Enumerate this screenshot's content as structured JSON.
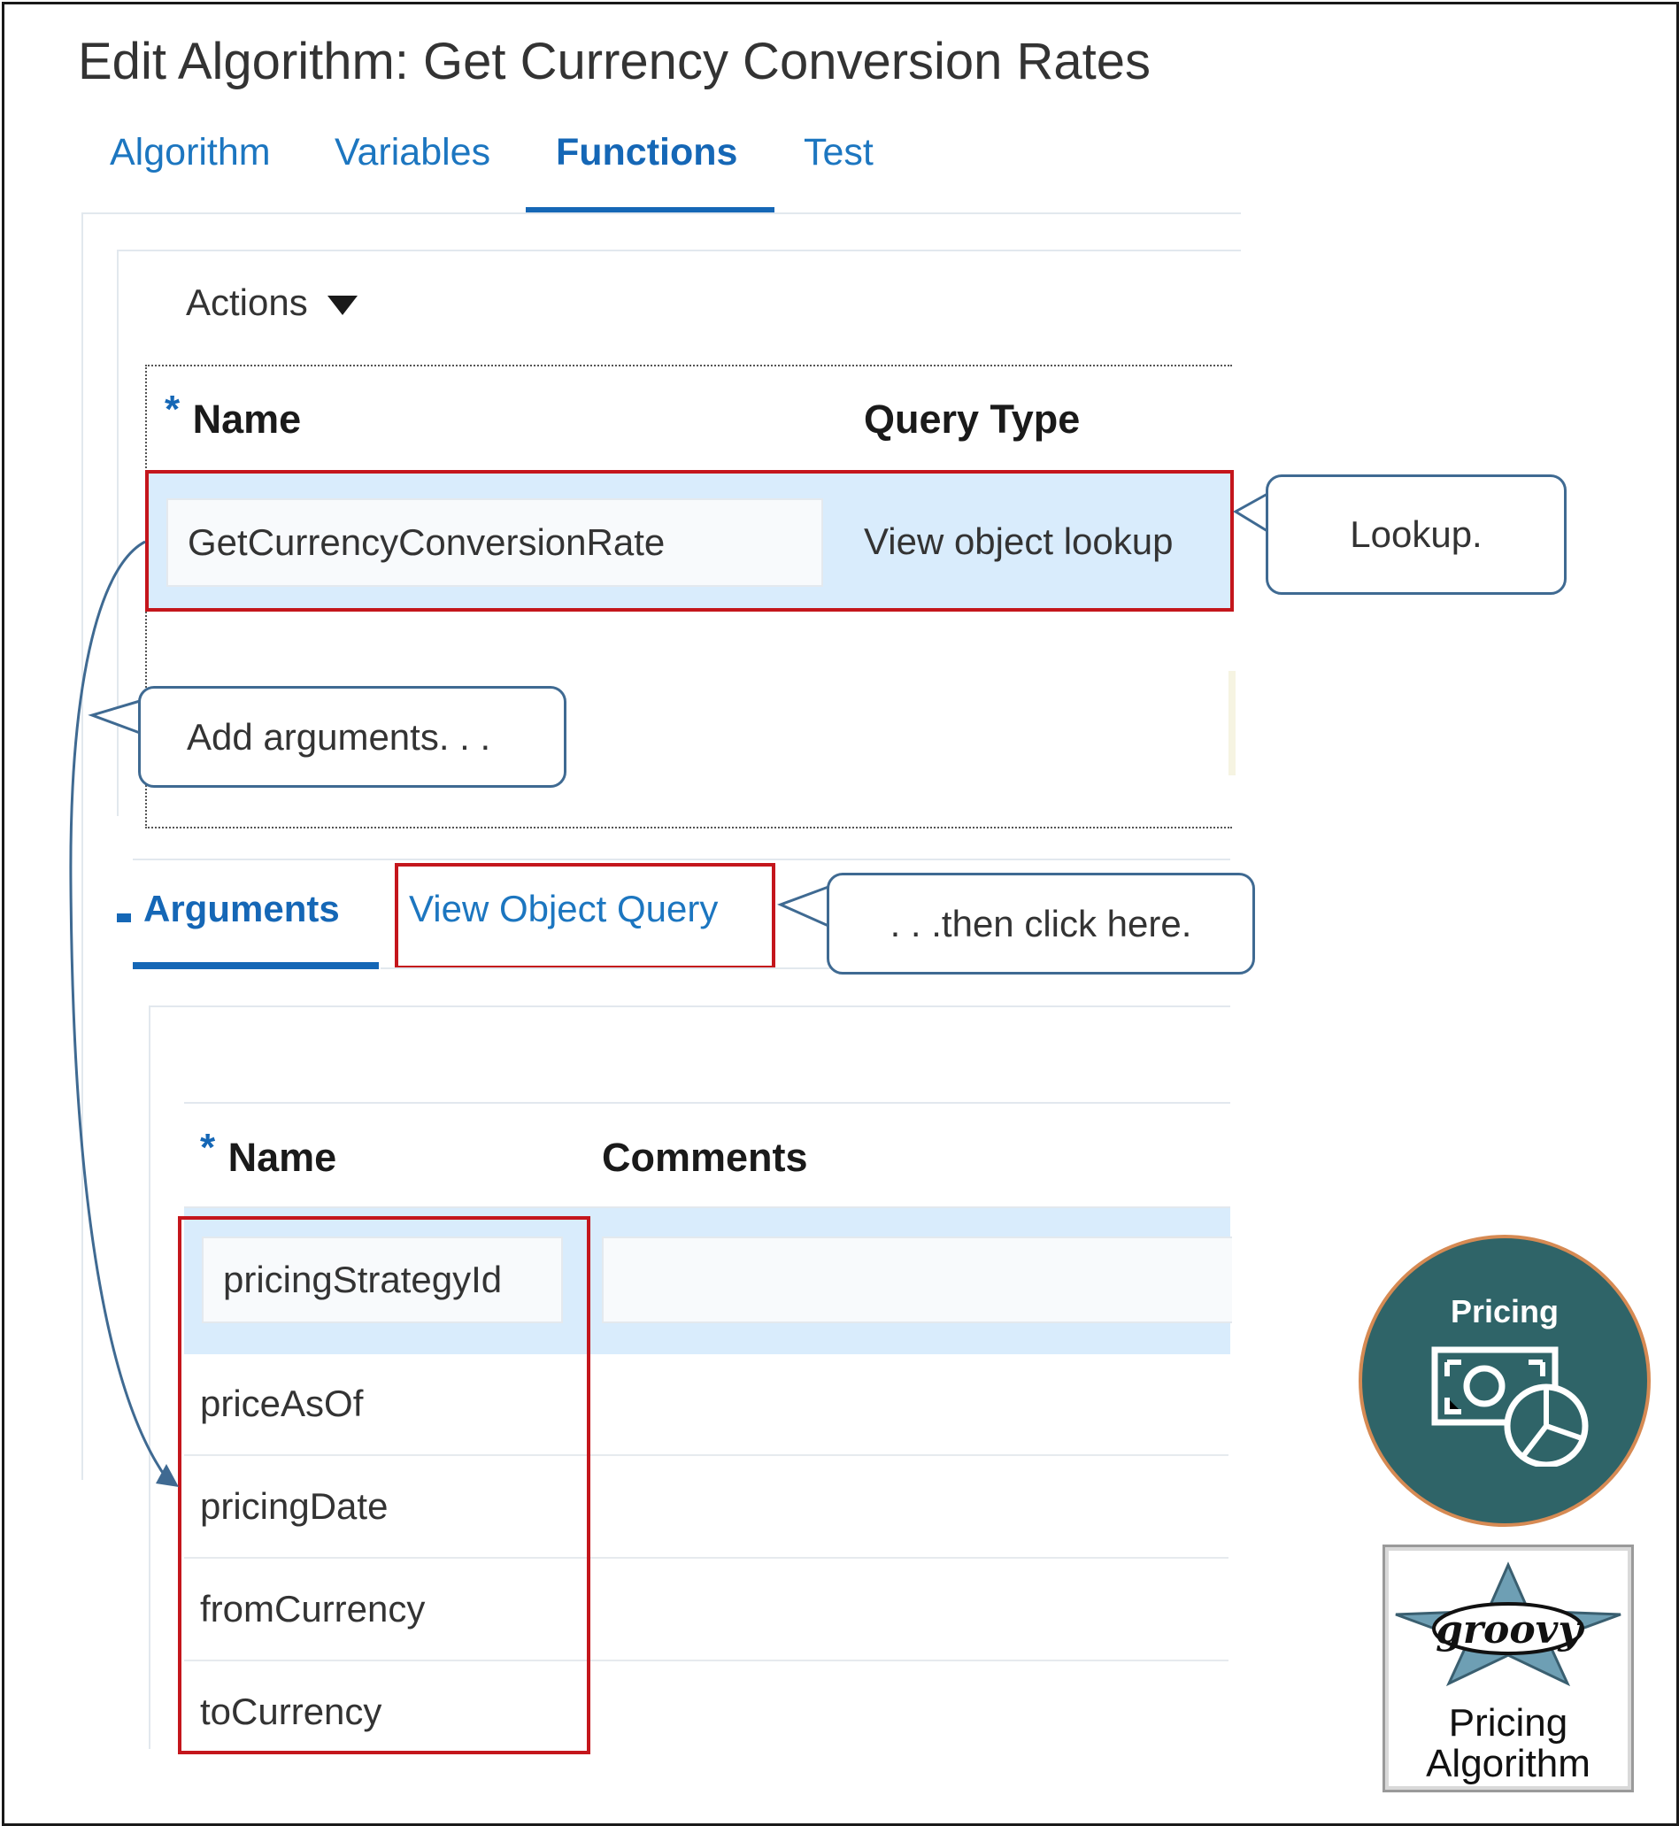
{
  "page": {
    "title": "Edit Algorithm: Get Currency Conversion Rates"
  },
  "tabs": [
    {
      "label": "Algorithm",
      "active": false
    },
    {
      "label": "Variables",
      "active": false
    },
    {
      "label": "Functions",
      "active": true
    },
    {
      "label": "Test",
      "active": false
    }
  ],
  "functions": {
    "actions_label": "Actions",
    "required_marker": "*",
    "columns": {
      "name": "Name",
      "query_type": "Query Type"
    },
    "rows": [
      {
        "name": "GetCurrencyConversionRate",
        "query_type": "View object lookup",
        "selected": true
      }
    ]
  },
  "subtabs": [
    {
      "label": "Arguments",
      "active": true
    },
    {
      "label": "View Object Query",
      "active": false
    }
  ],
  "arguments": {
    "required_marker": "*",
    "columns": {
      "name": "Name",
      "comments": "Comments"
    },
    "rows": [
      {
        "name": "pricingStrategyId",
        "comments": ""
      },
      {
        "name": "priceAsOf",
        "comments": ""
      },
      {
        "name": "pricingDate",
        "comments": ""
      },
      {
        "name": "fromCurrency",
        "comments": ""
      },
      {
        "name": "toCurrency",
        "comments": ""
      }
    ]
  },
  "callouts": {
    "lookup": "Lookup.",
    "add_arguments": "Add arguments. . .",
    "then_click": ". . .then click here."
  },
  "badges": {
    "pricing": {
      "label": "Pricing"
    },
    "groovy": {
      "line1": "Pricing",
      "line2": "Algorithm",
      "logo_icon": "groovy-star-logo"
    }
  },
  "colors": {
    "link_blue": "#1c76c0",
    "selected_row": "#d9ecfc",
    "highlight_red": "#c4161c",
    "callout_border": "#3f6a92",
    "badge_teal": "#2f6468",
    "badge_ring": "#d68a53"
  }
}
